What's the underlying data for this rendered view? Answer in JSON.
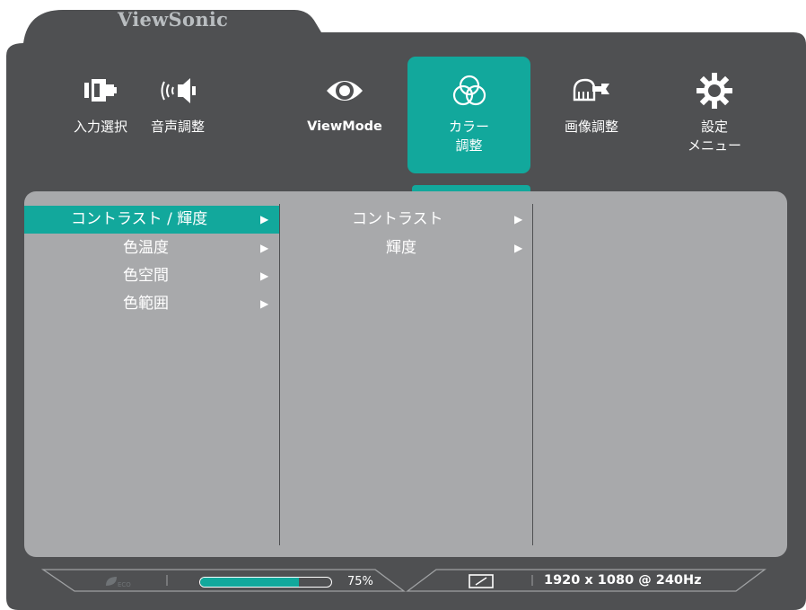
{
  "brand": "ViewSonic",
  "colors": {
    "frame": "#4f5052",
    "panel": "#a8a9ab",
    "accent": "#12a89c",
    "text": "#ffffff"
  },
  "tabs": [
    {
      "lines": [
        "入力選択"
      ],
      "icon": "input-source-icon",
      "active": false
    },
    {
      "lines": [
        "音声調整"
      ],
      "icon": "speaker-icon",
      "active": false
    },
    {
      "lines": [
        "ViewMode"
      ],
      "icon": "eye-icon",
      "active": false
    },
    {
      "lines": [
        "カラー",
        "調整"
      ],
      "icon": "color-circles-icon",
      "active": true
    },
    {
      "lines": [
        "画像調整"
      ],
      "icon": "hand-wrench-icon",
      "active": false
    },
    {
      "lines": [
        "設定",
        "メニュー"
      ],
      "icon": "gear-icon",
      "active": false
    }
  ],
  "menu_level1": [
    {
      "label": "コントラスト / 輝度",
      "selected": true
    },
    {
      "label": "色温度",
      "selected": false
    },
    {
      "label": "色空間",
      "selected": false
    },
    {
      "label": "色範囲",
      "selected": false
    }
  ],
  "menu_level2": [
    {
      "label": "コントラスト"
    },
    {
      "label": "輝度"
    }
  ],
  "submenu_arrow": "▶",
  "status_bar": {
    "eco_icon": "eco-leaf-icon",
    "brightness_percent": 75,
    "brightness_label": "75%",
    "aspect_icon": "aspect-ratio-icon",
    "resolution": "1920 x 1080 @ 240Hz"
  }
}
